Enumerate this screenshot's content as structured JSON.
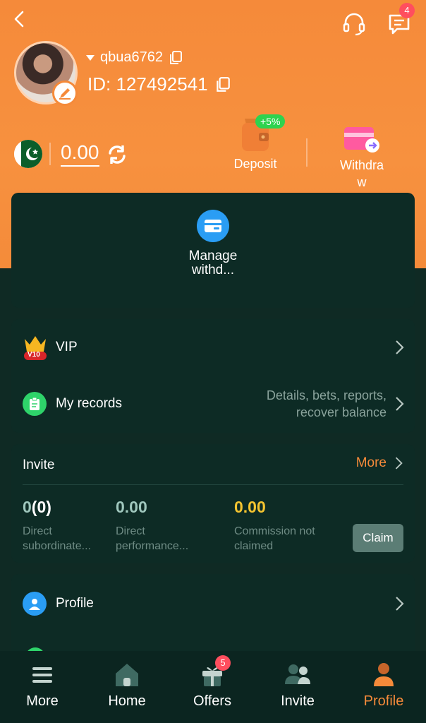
{
  "header": {
    "support_badge": "",
    "messages_badge": "4",
    "username": "qbua6762",
    "user_id": "ID: 127492541",
    "balance": "0.00",
    "deposit_label": "Deposit",
    "deposit_bonus": "+5%",
    "withdraw_label_line1": "Withdra",
    "withdraw_label_line2": "w"
  },
  "manage_card": {
    "label_line1": "Manage",
    "label_line2": "withd..."
  },
  "menu": {
    "vip_label": "VIP",
    "vip_level": "V10",
    "records_label": "My records",
    "records_hint_line1": "Details, bets, reports,",
    "records_hint_line2": "recover balance"
  },
  "invite": {
    "title": "Invite",
    "more_label": "More",
    "direct_sub_count": "0",
    "direct_sub_extra": "(0)",
    "direct_sub_label": "Direct subordinate...",
    "direct_perf_value": "0.00",
    "direct_perf_label": "Direct performance...",
    "commission_value": "0.00",
    "commission_label_line1": "Commission not",
    "commission_label_line2": "claimed",
    "claim_label": "Claim"
  },
  "profile_card": {
    "profile_label": "Profile"
  },
  "bottom_nav": {
    "more": "More",
    "home": "Home",
    "offers": "Offers",
    "offers_badge": "5",
    "invite": "Invite",
    "profile": "Profile"
  },
  "colors": {
    "accent_orange": "#f58a3a",
    "bg_dark": "#0f2a24",
    "card_bg": "#0d2b25",
    "commission_yellow": "#f4c430",
    "value_teal": "#9fc7bd"
  }
}
